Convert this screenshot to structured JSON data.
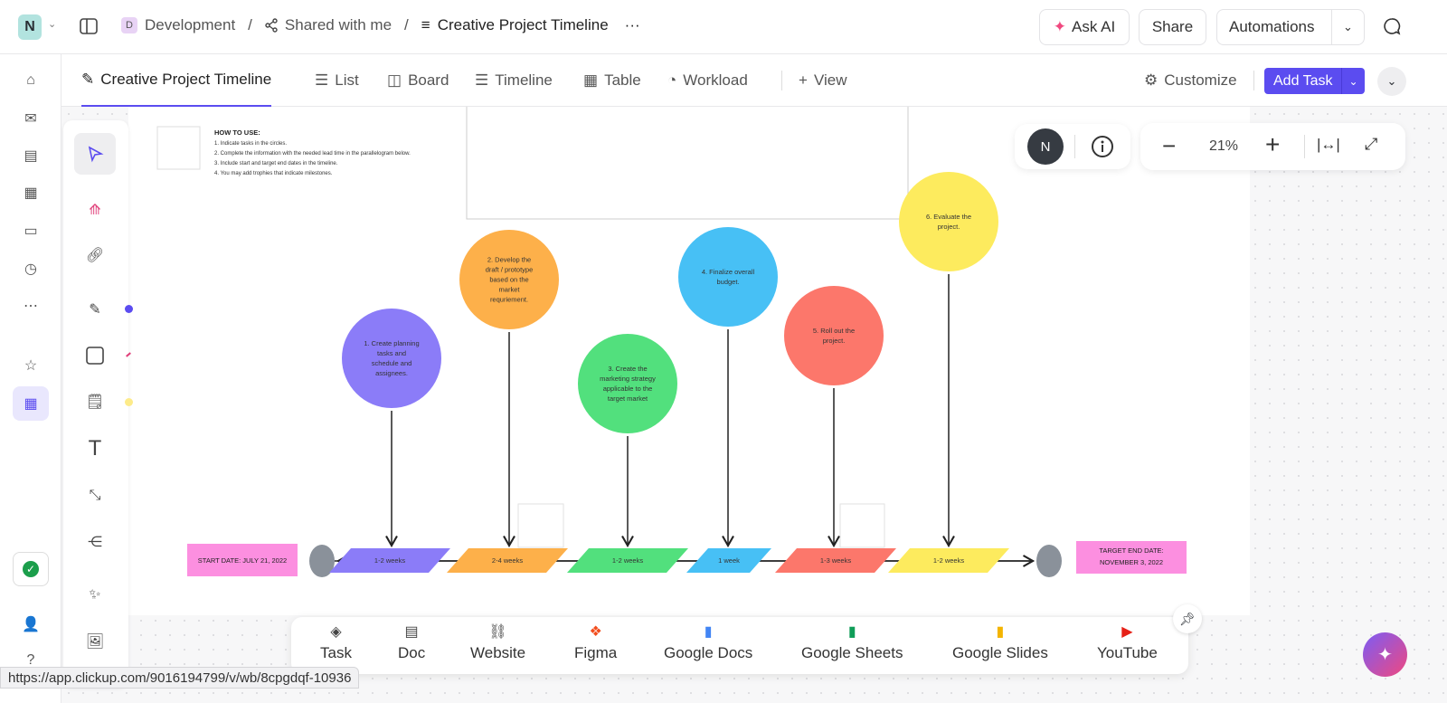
{
  "topbar": {
    "workspace_initial": "N",
    "breadcrumb": [
      {
        "badge": "D",
        "label": "Development"
      },
      {
        "label": "Shared with me"
      },
      {
        "label": "Creative Project Timeline"
      }
    ],
    "more": "···",
    "ask_ai": "Ask AI",
    "share": "Share",
    "automations": "Automations"
  },
  "tabs": [
    {
      "label": "Creative Project Timeline",
      "active": true
    },
    {
      "label": "List"
    },
    {
      "label": "Board"
    },
    {
      "label": "Timeline"
    },
    {
      "label": "Table"
    },
    {
      "label": "Workload"
    },
    {
      "label": "View"
    }
  ],
  "toolbar_right": {
    "customize": "Customize",
    "add_task": "Add Task",
    "accent": "#5b4cf0"
  },
  "canvas_controls": {
    "avatar": "N",
    "zoom": "21%"
  },
  "whiteboard": {
    "how_to": {
      "title": "HOW TO USE:",
      "steps": [
        "1. Indicate tasks in the circles.",
        "2. Complete the information with the needed lead time in the parallelogram below.",
        "3. Include start and target end dates in the timeline.",
        "4. You may add trophies that indicate milestones."
      ]
    },
    "tasks": [
      {
        "text": [
          "1. Create planning",
          "tasks and",
          "schedule and",
          "assignees."
        ],
        "duration": "1-2 weeks",
        "color": "#8b7cf8"
      },
      {
        "text": [
          "2. Develop the",
          "draft / prototype",
          "based on the",
          "market",
          "requriement."
        ],
        "duration": "2-4 weeks",
        "color": "#fdb04a"
      },
      {
        "text": [
          "3. Create the",
          "marketing strategy",
          "applicable to the",
          "target market"
        ],
        "duration": "1-2 weeks",
        "color": "#52e07d"
      },
      {
        "text": [
          "4. Finalize overall",
          "budget."
        ],
        "duration": "1 week",
        "color": "#47c0f5"
      },
      {
        "text": [
          "5. Roll out the",
          "project."
        ],
        "duration": "1-3 weeks",
        "color": "#fc776b"
      },
      {
        "text": [
          "6. Evaluate the",
          "project."
        ],
        "duration": "1-2 weeks",
        "color": "#fdeb5e"
      }
    ],
    "start": "START DATE: JULY 21, 2022",
    "end": [
      "TARGET END DATE:",
      "NOVEMBER 3, 2022"
    ]
  },
  "bottombar": [
    {
      "label": "Task",
      "icon": "layers-icon"
    },
    {
      "label": "Doc",
      "icon": "doc-icon"
    },
    {
      "label": "Website",
      "icon": "link-icon"
    },
    {
      "label": "Figma",
      "icon": "figma-icon"
    },
    {
      "label": "Google Docs",
      "icon": "google-docs-icon"
    },
    {
      "label": "Google Sheets",
      "icon": "google-sheets-icon"
    },
    {
      "label": "Google Slides",
      "icon": "google-slides-icon"
    },
    {
      "label": "YouTube",
      "icon": "youtube-icon"
    }
  ],
  "status_url": "https://app.clickup.com/9016194799/v/wb/8cpgdqf-10936"
}
